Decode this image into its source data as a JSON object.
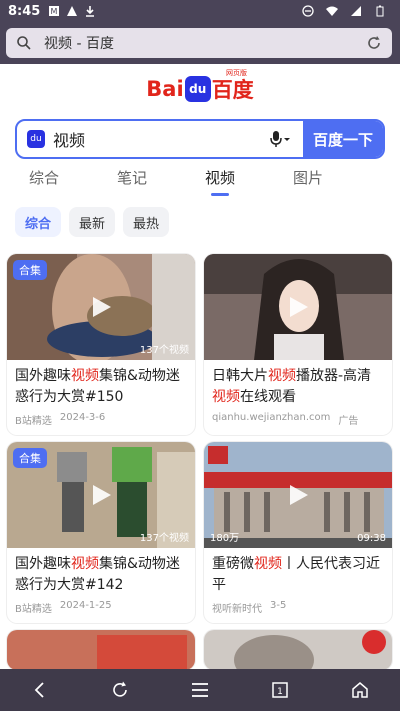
{
  "status": {
    "time": "8:45"
  },
  "browser": {
    "url_text": "视频 - 百度"
  },
  "logo": {
    "bai": "Bai",
    "du": "du",
    "cn": "百度",
    "tag": "网页版"
  },
  "search": {
    "query": "视频",
    "button": "百度一下"
  },
  "tabs": [
    {
      "label": "综合"
    },
    {
      "label": "笔记"
    },
    {
      "label": "视频"
    },
    {
      "label": "图片"
    }
  ],
  "filters": [
    "综合",
    "最新",
    "最热"
  ],
  "results": [
    {
      "badge": "合集",
      "title_pre": "国外趣味",
      "title_hl": "视频",
      "title_post": "集锦&动物迷惑行为大赏#150",
      "source": "B站精选",
      "date": "2024-3-6",
      "views": "137个视频"
    },
    {
      "badge": "",
      "title_pre": "日韩大片",
      "title_hl": "视频",
      "title_post": "播放器-高清",
      "title_hl2": "视频",
      "title_post2": "在线观看",
      "source": "qianhu.wejianzhan.com",
      "date": "广告",
      "views": ""
    },
    {
      "badge": "合集",
      "title_pre": "国外趣味",
      "title_hl": "视频",
      "title_post": "集锦&动物迷惑行为大赏#142",
      "source": "B站精选",
      "date": "2024-1-25",
      "views": "137个视频"
    },
    {
      "badge": "",
      "title_pre": "重磅微",
      "title_hl": "视频",
      "title_post": "丨人民代表习近平",
      "source": "视听新时代",
      "date": "3-5",
      "views": "180万",
      "duration": "09:38"
    }
  ],
  "colors": {
    "accent": "#4e6ef2",
    "brand_red": "#e1251b"
  }
}
